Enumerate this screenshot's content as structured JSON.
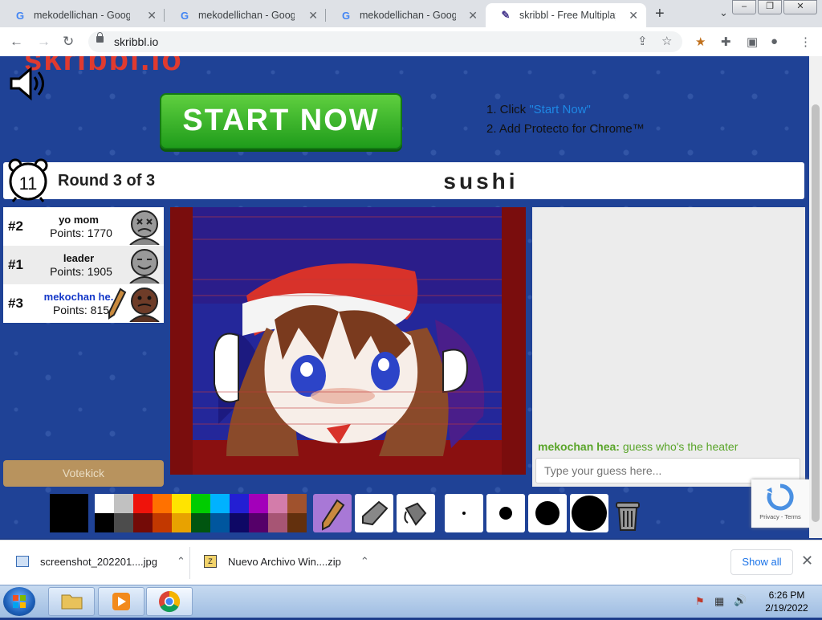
{
  "browser": {
    "tabs": [
      {
        "title": "mekodellichan - Google S",
        "active": false
      },
      {
        "title": "mekodellichan - Google S",
        "active": false
      },
      {
        "title": "mekodellichan - Google S",
        "active": false
      },
      {
        "title": "skribbl - Free Multiplayer",
        "active": true
      }
    ],
    "url": "skribbl.io"
  },
  "ad": {
    "button": "START NOW",
    "step1_prefix": "1. Click ",
    "step1_link": "\"Start Now\"",
    "step2": "2. Add Protecto for Chrome™"
  },
  "game": {
    "timer": "11",
    "round": "Round 3 of 3",
    "word": "sushi",
    "players": [
      {
        "rank": "#2",
        "name": "yo mom",
        "points": "Points: 1770",
        "me": false
      },
      {
        "rank": "#1",
        "name": "leader",
        "points": "Points: 1905",
        "me": false
      },
      {
        "rank": "#3",
        "name": "mekochan he.",
        "points": "Points: 815",
        "me": true
      }
    ],
    "votekick": "Votekick",
    "chat": {
      "author": "mekochan hea:",
      "message": "guess who's the heater"
    },
    "guess_placeholder": "Type your guess here...",
    "palette_colors": [
      "#ffffff",
      "#c1c1c1",
      "#ef130b",
      "#ff7100",
      "#ffe400",
      "#00cc00",
      "#00b2ff",
      "#231fd3",
      "#a300ba",
      "#d37caa",
      "#a0522d",
      "#000000",
      "#4c4c4c",
      "#740b07",
      "#c23800",
      "#e8a200",
      "#005510",
      "#00569e",
      "#0e0865",
      "#550069",
      "#a75574",
      "#63300d"
    ],
    "current_color": "#000000"
  },
  "recaptcha": {
    "text": "Privacy - Terms"
  },
  "downloads": [
    {
      "name": "screenshot_202201....jpg"
    },
    {
      "name": "Nuevo Archivo Win....zip"
    }
  ],
  "downloads_show_all": "Show all",
  "taskbar": {
    "time": "6:26 PM",
    "date": "2/19/2022"
  }
}
